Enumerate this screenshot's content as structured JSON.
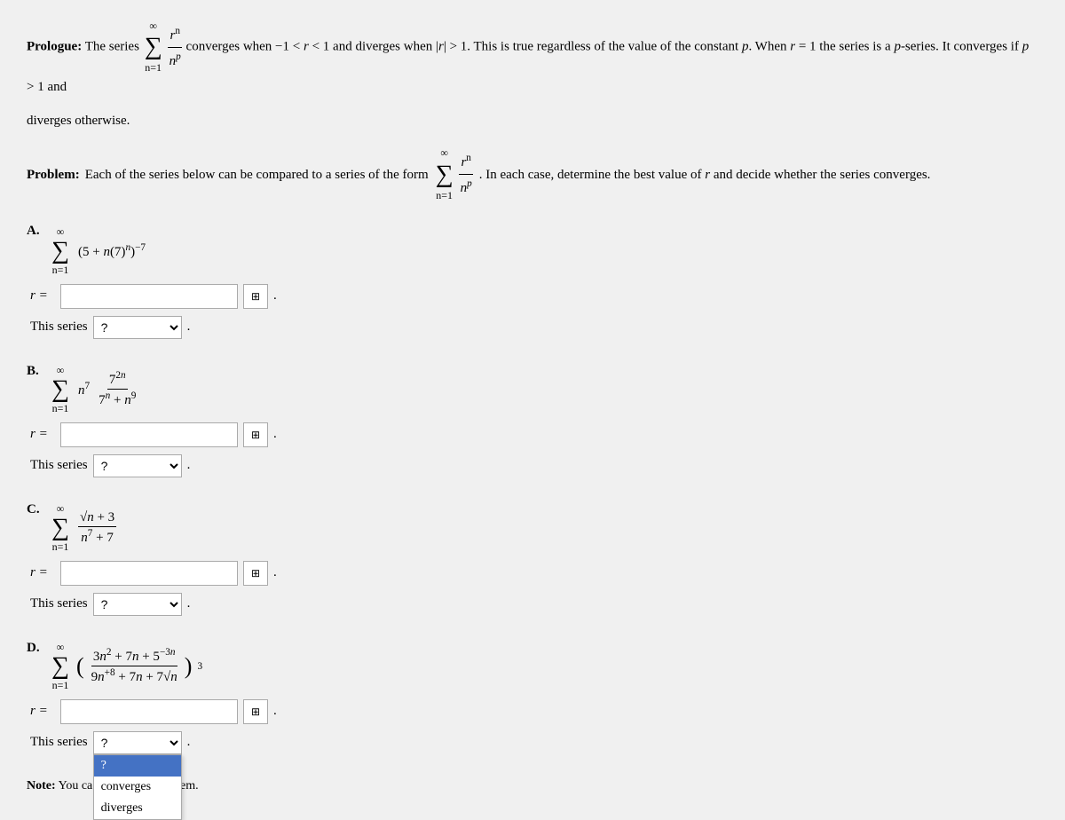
{
  "prologue": {
    "label": "Prologue:",
    "text": " The series ",
    "series_expr": "∑ rⁿ/nᵖ",
    "text2": " converges when −1 < r < 1 and diverges when |r| > 1. This is true regardless of the value of the constant p. When r = 1 the series is a p-series. It converges if p > 1 and diverges otherwise."
  },
  "problem": {
    "label": "Problem:",
    "text": " Each of the series below can be compared to a series of the form ",
    "series_expr": "∑ rⁿ/nᵖ",
    "text2": ". In each case, determine the best value of r and decide whether the series converges."
  },
  "parts": [
    {
      "id": "A",
      "r_value": "",
      "r_placeholder": "",
      "series_choice": "?",
      "expr_label": "A."
    },
    {
      "id": "B",
      "r_value": "",
      "r_placeholder": "",
      "series_choice": "?",
      "expr_label": "B."
    },
    {
      "id": "C",
      "r_value": "",
      "r_placeholder": "",
      "series_choice": "?",
      "expr_label": "C."
    },
    {
      "id": "D",
      "r_value": "",
      "r_placeholder": "",
      "series_choice": "?",
      "expr_label": "D."
    }
  ],
  "labels": {
    "r_eq": "r =",
    "this_series": "This series",
    "dot": ".",
    "note": "Note: You ca",
    "note2": "edit on this problem."
  },
  "dropdown_options": [
    "?",
    "converges",
    "diverges"
  ],
  "calc_icon": "⊞",
  "sigma_upper": "∞",
  "sigma_lower": "n=1"
}
